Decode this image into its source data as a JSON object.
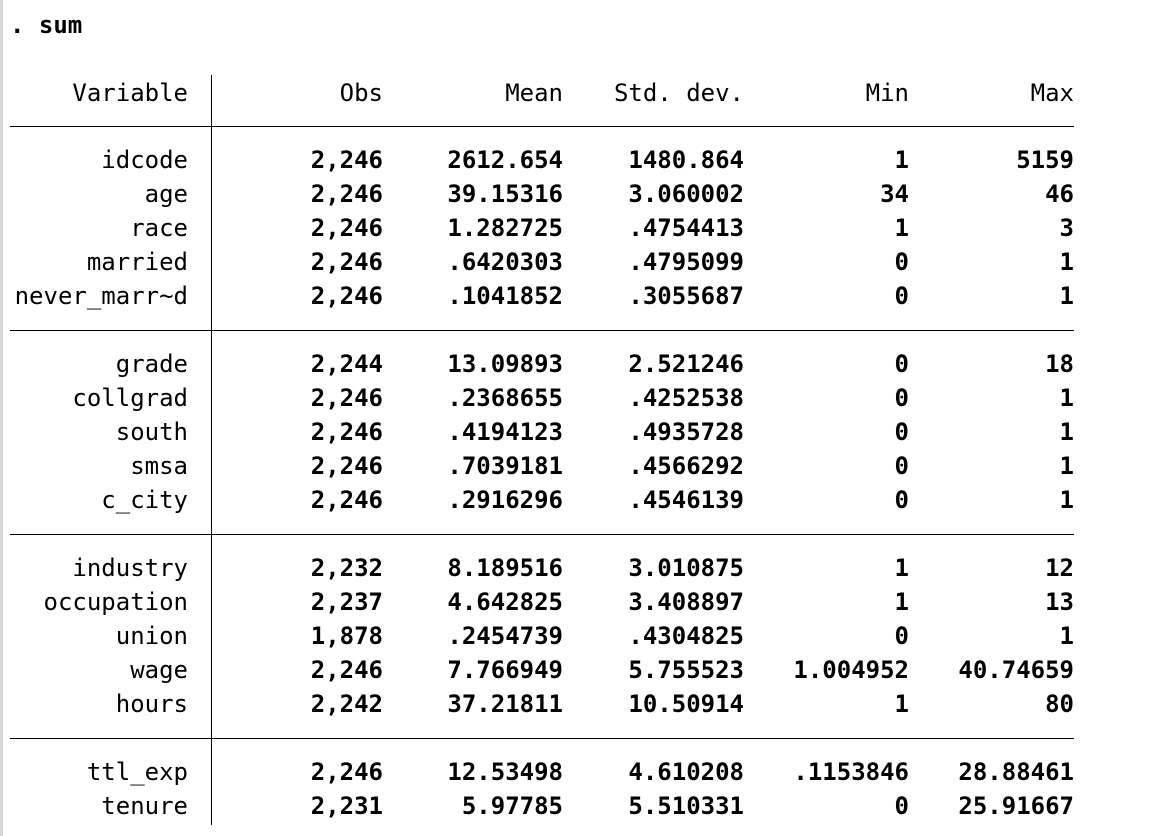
{
  "command": ". sum",
  "headers": {
    "variable": "Variable",
    "obs": "Obs",
    "mean": "Mean",
    "sd": "Std. dev.",
    "min": "Min",
    "max": "Max"
  },
  "rows": [
    {
      "var": "idcode",
      "obs": "2,246",
      "mean": "2612.654",
      "sd": "1480.864",
      "min": "1",
      "max": "5159"
    },
    {
      "var": "age",
      "obs": "2,246",
      "mean": "39.15316",
      "sd": "3.060002",
      "min": "34",
      "max": "46"
    },
    {
      "var": "race",
      "obs": "2,246",
      "mean": "1.282725",
      "sd": ".4754413",
      "min": "1",
      "max": "3"
    },
    {
      "var": "married",
      "obs": "2,246",
      "mean": ".6420303",
      "sd": ".4795099",
      "min": "0",
      "max": "1"
    },
    {
      "var": "never_marr~d",
      "obs": "2,246",
      "mean": ".1041852",
      "sd": ".3055687",
      "min": "0",
      "max": "1"
    },
    {
      "var": "grade",
      "obs": "2,244",
      "mean": "13.09893",
      "sd": "2.521246",
      "min": "0",
      "max": "18"
    },
    {
      "var": "collgrad",
      "obs": "2,246",
      "mean": ".2368655",
      "sd": ".4252538",
      "min": "0",
      "max": "1"
    },
    {
      "var": "south",
      "obs": "2,246",
      "mean": ".4194123",
      "sd": ".4935728",
      "min": "0",
      "max": "1"
    },
    {
      "var": "smsa",
      "obs": "2,246",
      "mean": ".7039181",
      "sd": ".4566292",
      "min": "0",
      "max": "1"
    },
    {
      "var": "c_city",
      "obs": "2,246",
      "mean": ".2916296",
      "sd": ".4546139",
      "min": "0",
      "max": "1"
    },
    {
      "var": "industry",
      "obs": "2,232",
      "mean": "8.189516",
      "sd": "3.010875",
      "min": "1",
      "max": "12"
    },
    {
      "var": "occupation",
      "obs": "2,237",
      "mean": "4.642825",
      "sd": "3.408897",
      "min": "1",
      "max": "13"
    },
    {
      "var": "union",
      "obs": "1,878",
      "mean": ".2454739",
      "sd": ".4304825",
      "min": "0",
      "max": "1"
    },
    {
      "var": "wage",
      "obs": "2,246",
      "mean": "7.766949",
      "sd": "5.755523",
      "min": "1.004952",
      "max": "40.74659"
    },
    {
      "var": "hours",
      "obs": "2,242",
      "mean": "37.21811",
      "sd": "10.50914",
      "min": "1",
      "max": "80"
    },
    {
      "var": "ttl_exp",
      "obs": "2,246",
      "mean": "12.53498",
      "sd": "4.610208",
      "min": ".1153846",
      "max": "28.88461"
    },
    {
      "var": "tenure",
      "obs": "2,231",
      "mean": "5.97785",
      "sd": "5.510331",
      "min": "0",
      "max": "25.91667"
    }
  ]
}
